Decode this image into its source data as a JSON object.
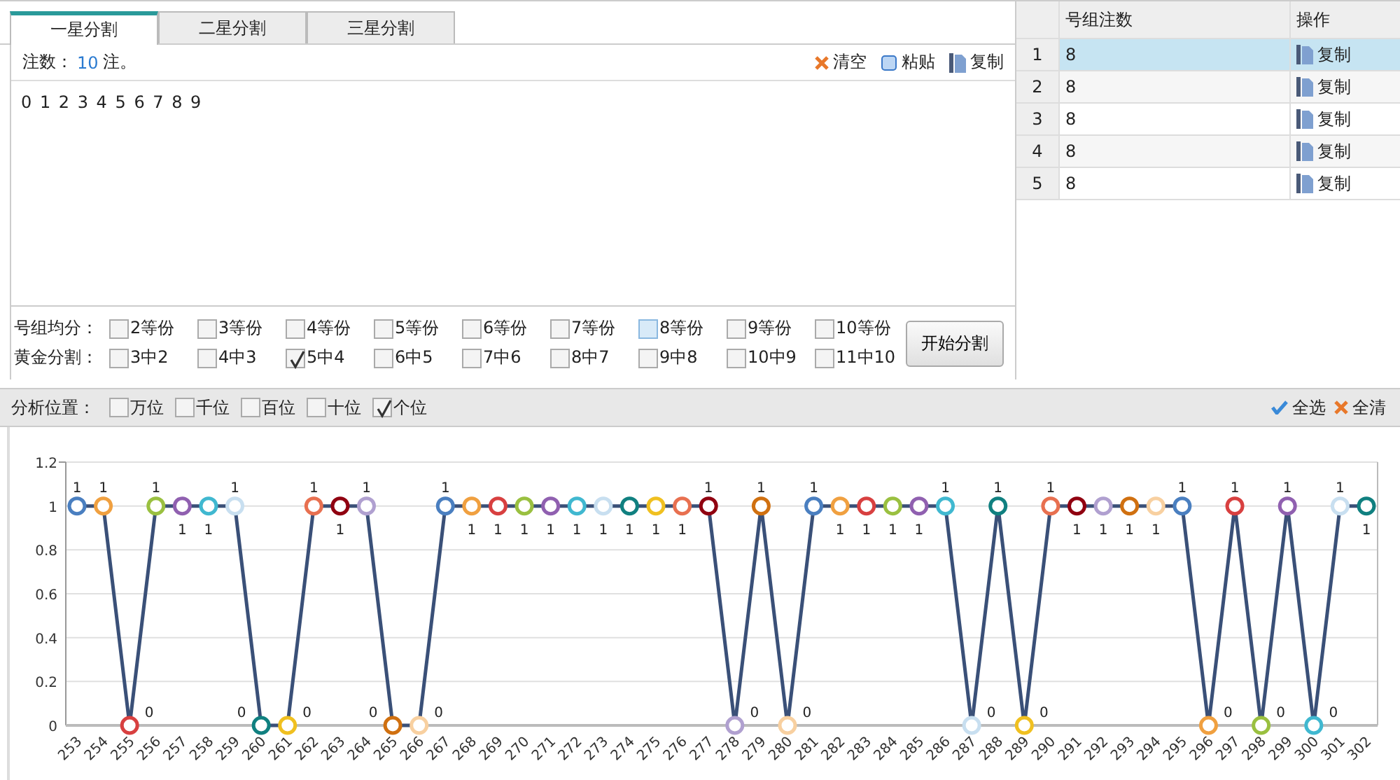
{
  "tabs": [
    {
      "label": "一星分割",
      "selected": true
    },
    {
      "label": "二星分割",
      "selected": false
    },
    {
      "label": "三星分割",
      "selected": false
    }
  ],
  "editor": {
    "count_label": "注数：",
    "count": "10",
    "count_unit": "注。",
    "actions": [
      {
        "kind": "clear",
        "label": "清空"
      },
      {
        "kind": "paste",
        "label": "粘贴"
      },
      {
        "kind": "copy",
        "label": "复制"
      }
    ],
    "content": "0 1 2 3 4 5 6 7 8 9"
  },
  "even_split": {
    "label": "号组均分：",
    "options": [
      {
        "label": "2等份",
        "checked": false,
        "hover": false
      },
      {
        "label": "3等份",
        "checked": false,
        "hover": false
      },
      {
        "label": "4等份",
        "checked": false,
        "hover": false
      },
      {
        "label": "5等份",
        "checked": false,
        "hover": false
      },
      {
        "label": "6等份",
        "checked": false,
        "hover": false
      },
      {
        "label": "7等份",
        "checked": false,
        "hover": false
      },
      {
        "label": "8等份",
        "checked": false,
        "hover": true
      },
      {
        "label": "9等份",
        "checked": false,
        "hover": false
      },
      {
        "label": "10等份",
        "checked": false,
        "hover": false
      }
    ]
  },
  "golden_split": {
    "label": "黄金分割：",
    "options": [
      {
        "label": "3中2",
        "checked": false
      },
      {
        "label": "4中3",
        "checked": false
      },
      {
        "label": "5中4",
        "checked": true
      },
      {
        "label": "6中5",
        "checked": false
      },
      {
        "label": "7中6",
        "checked": false
      },
      {
        "label": "8中7",
        "checked": false
      },
      {
        "label": "9中8",
        "checked": false
      },
      {
        "label": "10中9",
        "checked": false
      },
      {
        "label": "11中10",
        "checked": false
      }
    ]
  },
  "start_button": "开始分割",
  "table": {
    "columns": [
      "号组注数",
      "操作"
    ],
    "rows": [
      {
        "index": "1",
        "count": "8",
        "action": "复制",
        "selected": true
      },
      {
        "index": "2",
        "count": "8",
        "action": "复制",
        "selected": false
      },
      {
        "index": "3",
        "count": "8",
        "action": "复制",
        "selected": false
      },
      {
        "index": "4",
        "count": "8",
        "action": "复制",
        "selected": false
      },
      {
        "index": "5",
        "count": "8",
        "action": "复制",
        "selected": false
      }
    ]
  },
  "positions": {
    "label": "分析位置：",
    "options": [
      {
        "label": "万位",
        "checked": false
      },
      {
        "label": "千位",
        "checked": false
      },
      {
        "label": "百位",
        "checked": false
      },
      {
        "label": "十位",
        "checked": false
      },
      {
        "label": "个位",
        "checked": true
      }
    ],
    "select_all": "全选",
    "clear_all": "全清"
  },
  "chart_data": {
    "type": "line",
    "categories": [
      "253",
      "254",
      "255",
      "256",
      "257",
      "258",
      "259",
      "260",
      "261",
      "262",
      "263",
      "264",
      "265",
      "266",
      "267",
      "268",
      "269",
      "270",
      "271",
      "272",
      "273",
      "274",
      "275",
      "276",
      "277",
      "278",
      "279",
      "280",
      "281",
      "282",
      "283",
      "284",
      "285",
      "286",
      "287",
      "288",
      "289",
      "290",
      "291",
      "292",
      "293",
      "294",
      "295",
      "296",
      "297",
      "298",
      "299",
      "300",
      "301",
      "302"
    ],
    "series": [
      {
        "color": "#3a5078",
        "marker": "circle",
        "values": [
          1,
          1,
          0,
          1,
          1,
          1,
          1,
          0,
          0,
          1,
          1,
          1,
          0,
          0,
          1,
          1,
          1,
          1,
          1,
          1,
          1,
          1,
          1,
          1,
          1,
          0,
          1,
          0,
          1,
          1,
          1,
          1,
          1,
          1,
          0,
          1,
          0,
          1,
          1,
          1,
          1,
          1,
          1,
          0,
          1,
          0,
          1,
          0,
          1,
          1
        ]
      }
    ],
    "ylim": [
      0,
      1.2
    ],
    "grid": true,
    "yticks": [
      0,
      {
        "value": 0.2,
        "label": "0.2"
      },
      {
        "value": 0.4,
        "label": "0.4"
      },
      {
        "value": 0.6,
        "label": "0.6"
      },
      {
        "value": 0.8,
        "label": "0.8"
      },
      1,
      {
        "value": 1.2,
        "label": "1.2"
      }
    ],
    "data_labels": true
  }
}
